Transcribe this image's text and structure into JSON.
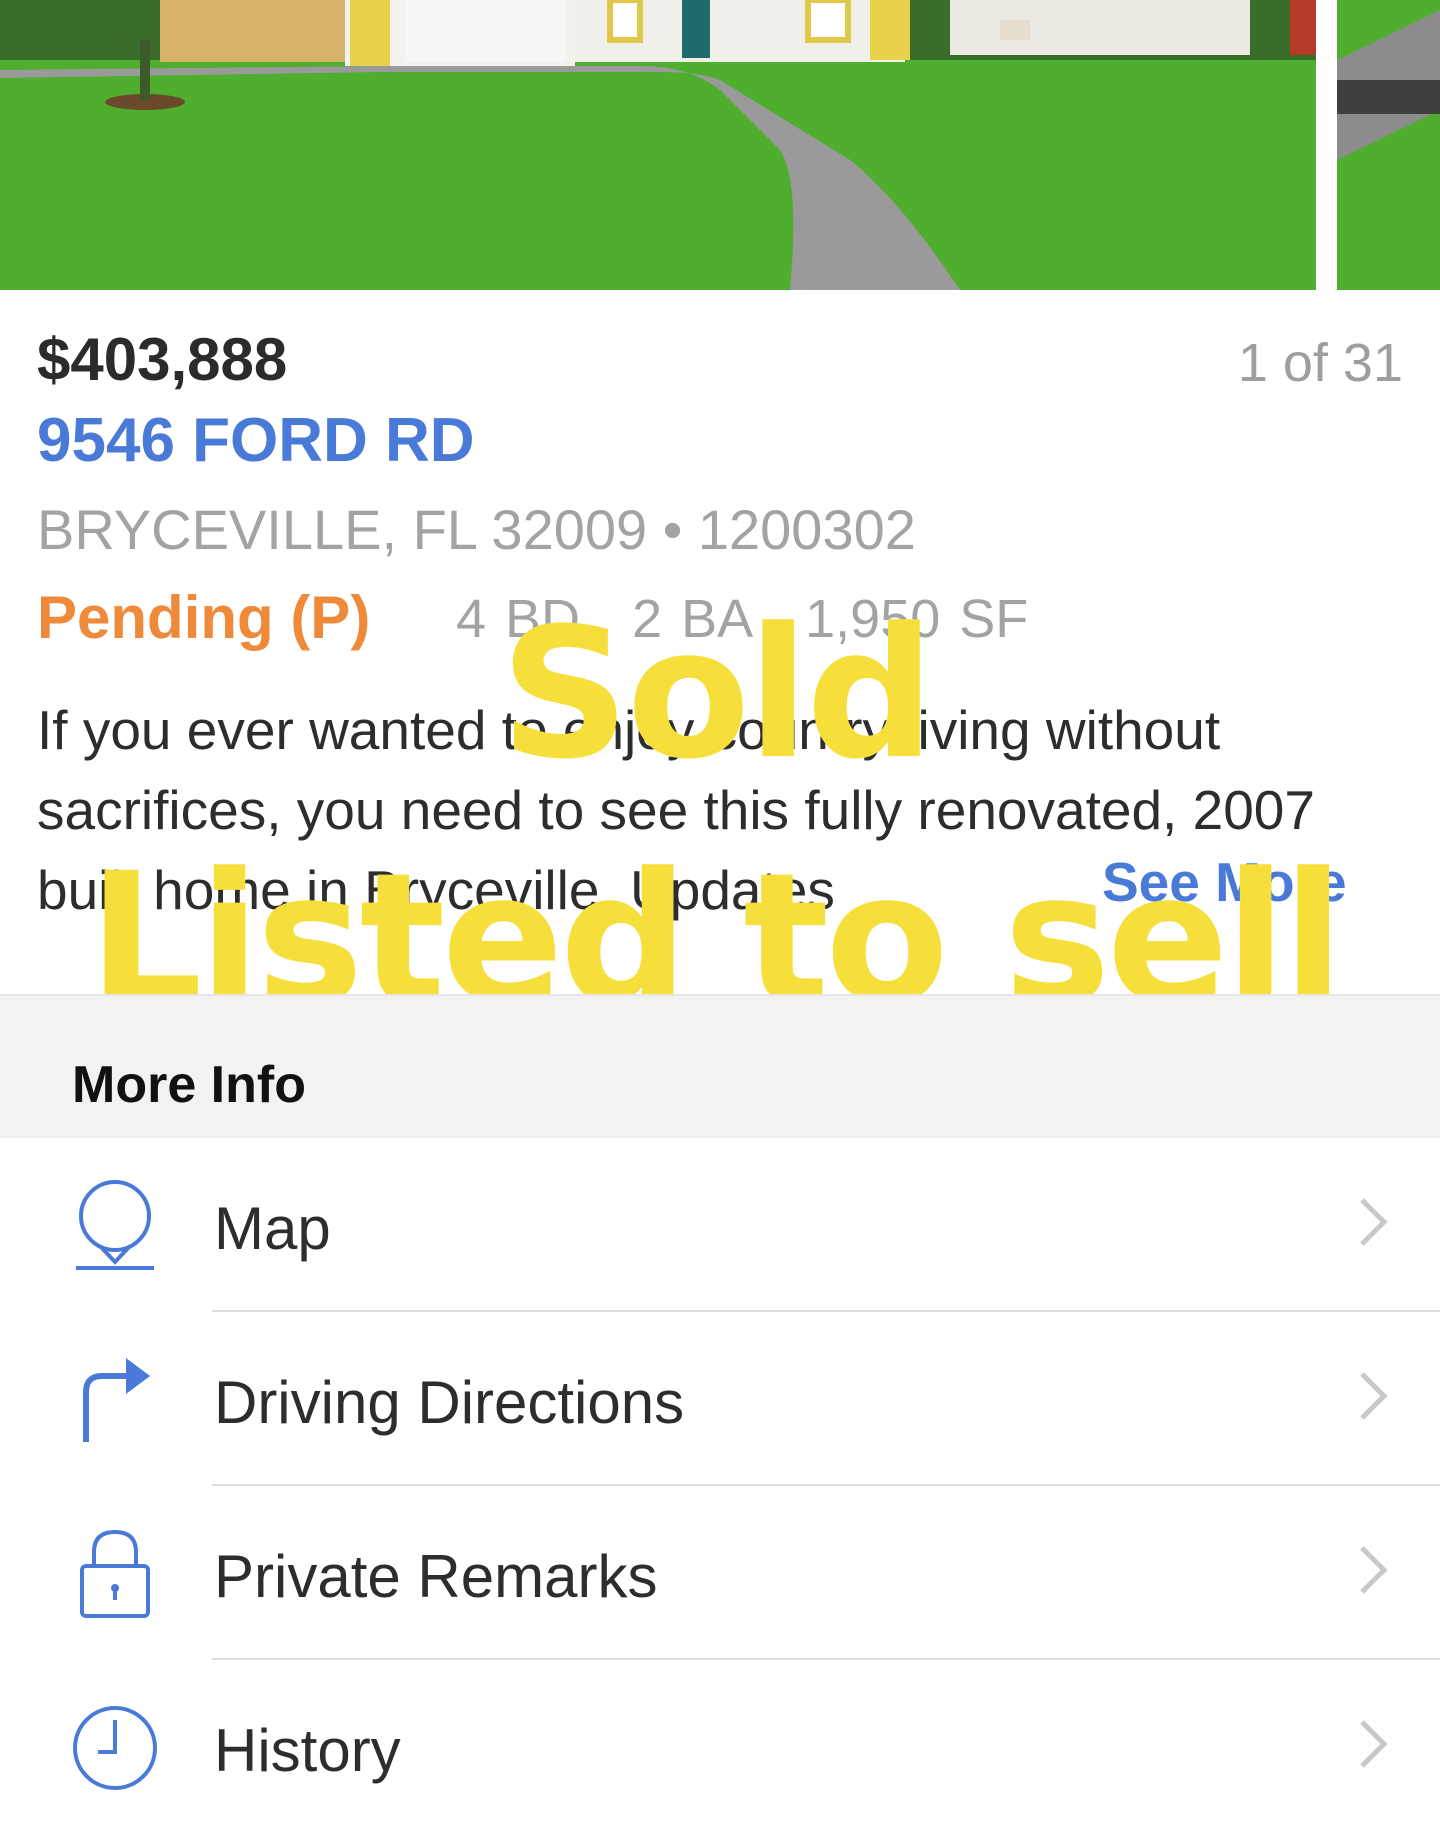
{
  "listing": {
    "price": "$403,888",
    "photo_counter": "1 of 31",
    "address": "9546 FORD RD",
    "city_line": "BRYCEVILLE, FL 32009 • 1200302",
    "status": "Pending (P)",
    "beds": "4 BD",
    "baths": "2 BA",
    "sqft": "1,950 SF",
    "description": "If you ever wanted to enjoy country living without sacrifices, you need to see this fully renovated, 2007 built home in Bryceville. Updates",
    "see_more": "See More"
  },
  "overlay": {
    "line1": "Sold",
    "line2": "Listed to sell",
    "color": "#f6df3a"
  },
  "more_info": {
    "title": "More Info",
    "items": [
      {
        "label": "Map",
        "icon": "map-pin-icon"
      },
      {
        "label": "Driving Directions",
        "icon": "turn-right-arrow-icon"
      },
      {
        "label": "Private Remarks",
        "icon": "lock-icon"
      },
      {
        "label": "History",
        "icon": "clock-icon"
      }
    ]
  },
  "colors": {
    "accent_blue": "#4a7ad8",
    "status_orange": "#ef8a3b",
    "muted_gray": "#a3a3a3"
  }
}
